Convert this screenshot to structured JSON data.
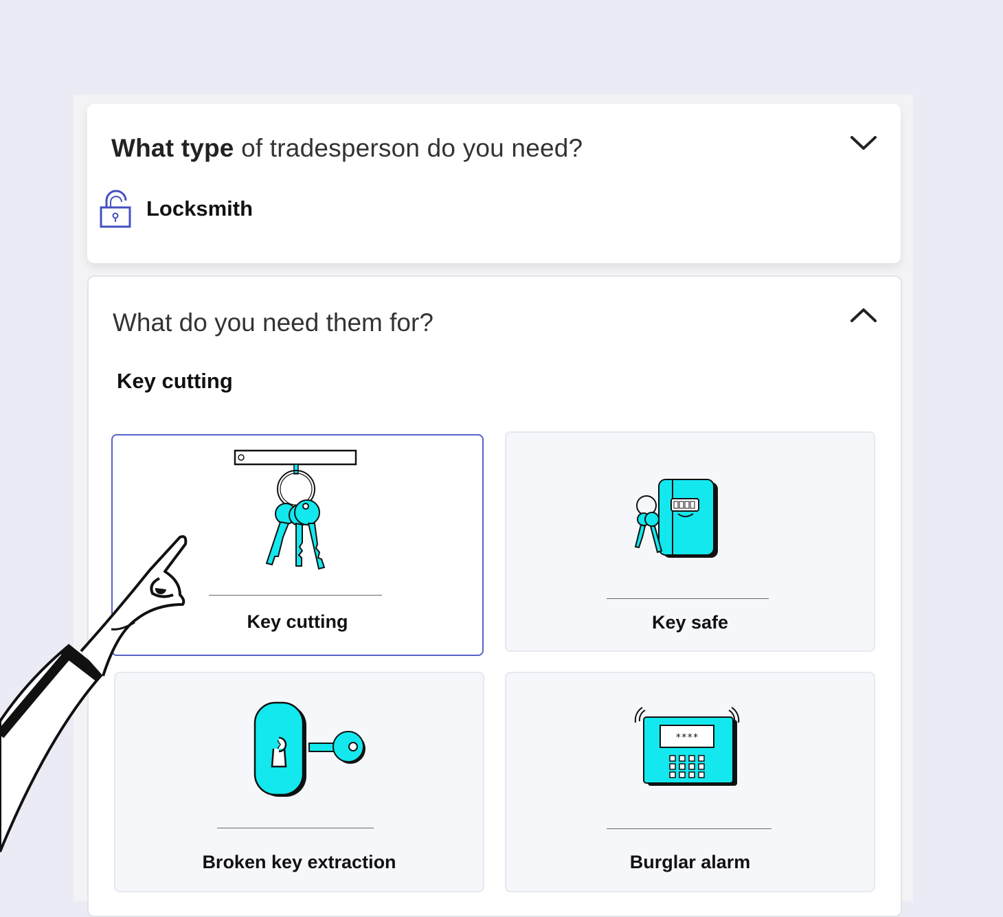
{
  "question1": {
    "bold": "What type",
    "rest": " of tradesperson do you need?",
    "selected": "Locksmith",
    "selected_icon": "padlock-icon",
    "toggle_icon": "chevron-down-icon"
  },
  "question2": {
    "title": "What do you need them for?",
    "selected": "Key cutting",
    "toggle_icon": "chevron-up-icon",
    "options": [
      {
        "label": "Key cutting",
        "icon": "keys-icon",
        "selected": true
      },
      {
        "label": "Key safe",
        "icon": "key-safe-icon",
        "selected": false
      },
      {
        "label": "Broken key extraction",
        "icon": "lock-and-key-icon",
        "selected": false
      },
      {
        "label": "Burglar alarm",
        "icon": "alarm-panel-icon",
        "selected": false
      }
    ]
  },
  "colors": {
    "accent": "#5563c8",
    "illustration_fill": "#13e8ee",
    "background": "#ebebf5"
  },
  "alarm_display": "****"
}
